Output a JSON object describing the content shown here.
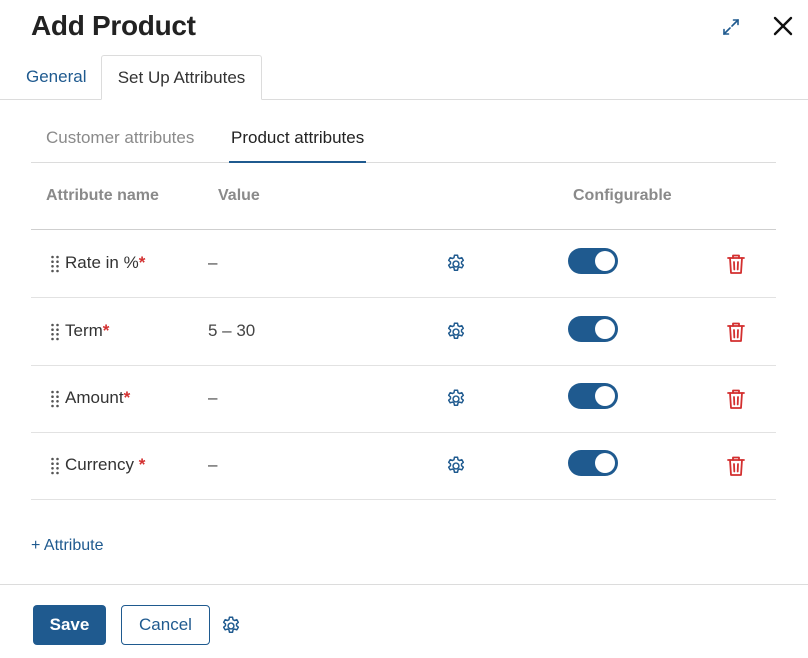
{
  "dialog": {
    "title": "Add Product",
    "expand_icon": "expand-icon",
    "close_icon": "close-icon"
  },
  "tabs": [
    {
      "label": "General",
      "active": false
    },
    {
      "label": "Set Up Attributes",
      "active": true
    }
  ],
  "sub_tabs": [
    {
      "label": "Customer attributes",
      "active": false
    },
    {
      "label": "Product attributes",
      "active": true
    }
  ],
  "table": {
    "columns": {
      "name": "Attribute name",
      "value": "Value",
      "configurable": "Configurable"
    },
    "rows": [
      {
        "name": "Rate in %",
        "required_mark": "*",
        "value": "–",
        "configurable": true
      },
      {
        "name": "Term",
        "required_mark": "*",
        "value": "5 – 30",
        "configurable": true
      },
      {
        "name": "Amount",
        "required_mark": "*",
        "value": "–",
        "configurable": true
      },
      {
        "name": "Currency ",
        "required_mark": "*",
        "value": "–",
        "configurable": true
      }
    ]
  },
  "add_attribute_label": "+ Attribute",
  "footer": {
    "save_label": "Save",
    "cancel_label": "Cancel"
  },
  "colors": {
    "accent": "#1f5a8f",
    "danger": "#d32f2f"
  }
}
